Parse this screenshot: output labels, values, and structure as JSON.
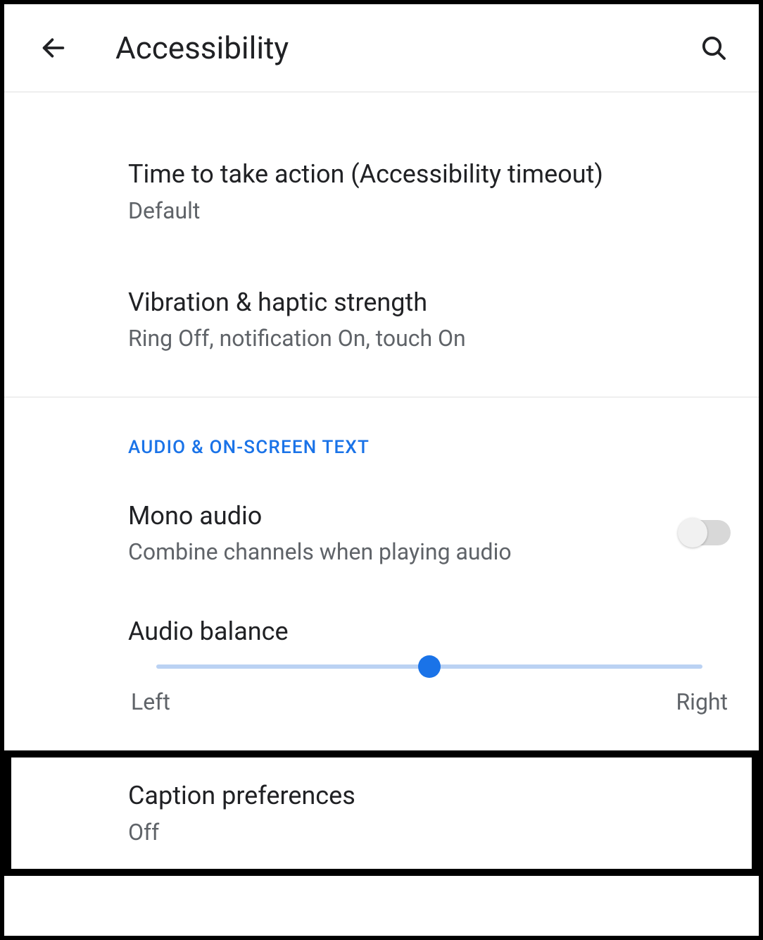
{
  "header": {
    "title": "Accessibility"
  },
  "items": {
    "timeout": {
      "title": "Time to take action (Accessibility timeout)",
      "subtitle": "Default"
    },
    "vibration": {
      "title": "Vibration & haptic strength",
      "subtitle": "Ring Off, notification On, touch On"
    }
  },
  "section": {
    "audio_header": "AUDIO & ON-SCREEN TEXT"
  },
  "mono_audio": {
    "title": "Mono audio",
    "subtitle": "Combine channels when playing audio",
    "enabled": false
  },
  "audio_balance": {
    "title": "Audio balance",
    "left_label": "Left",
    "right_label": "Right",
    "value": 50
  },
  "caption": {
    "title": "Caption preferences",
    "subtitle": "Off"
  },
  "colors": {
    "accent": "#1a73e8",
    "text_primary": "#202124",
    "text_secondary": "#5f6368"
  }
}
